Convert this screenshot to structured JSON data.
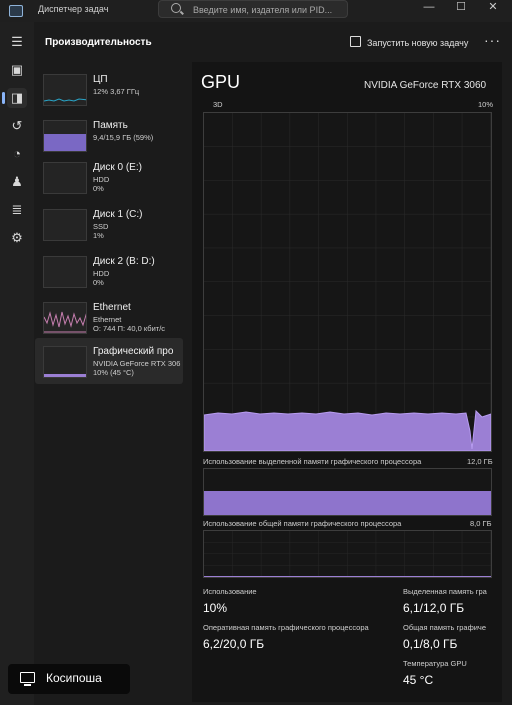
{
  "app": {
    "title": "Диспетчер задач"
  },
  "search": {
    "placeholder": "Введите имя, издателя или PID..."
  },
  "window_controls": {
    "minimize": "—",
    "maximize": "☐",
    "close": "✕"
  },
  "header": {
    "title": "Производительность",
    "run_task": "Запустить новую задачу",
    "more": "···"
  },
  "nav_icons": [
    "menu-icon",
    "processes-icon",
    "performance-icon",
    "history-icon",
    "startup-icon",
    "users-icon",
    "details-icon",
    "services-icon"
  ],
  "devices": [
    {
      "name": "ЦП",
      "line2": "12% 3,67 ГГц",
      "line3": "",
      "line4": ""
    },
    {
      "name": "Память",
      "line2": "9,4/15,9 ГБ (59%)",
      "line3": "",
      "line4": ""
    },
    {
      "name": "Диск 0 (E:)",
      "line2": "HDD",
      "line3": "0%",
      "line4": ""
    },
    {
      "name": "Диск 1 (C:)",
      "line2": "SSD",
      "line3": "1%",
      "line4": ""
    },
    {
      "name": "Диск 2 (B: D:)",
      "line2": "HDD",
      "line3": "0%",
      "line4": ""
    },
    {
      "name": "Ethernet",
      "line2": "Ethernet",
      "line3": "О: 744 П: 40,0 кбит/с",
      "line4": ""
    },
    {
      "name": "Графический про",
      "line2": "NVIDIA GeForce RTX 306",
      "line3": "10% (45 °C)",
      "line4": ""
    }
  ],
  "gpu": {
    "title": "GPU",
    "name": "NVIDIA GeForce RTX 3060",
    "engine_label": "3D",
    "engine_max": "10%",
    "dedicated_label": "Использование выделенной памяти графического процессора",
    "dedicated_max": "12,0 ГБ",
    "shared_label": "Использование общей памяти графического процессора",
    "shared_max": "8,0 ГБ"
  },
  "stats": {
    "usage_label": "Использование",
    "usage_value": "10%",
    "gpu_mem_label": "Оперативная память графического процессора",
    "gpu_mem_value": "6,2/20,0 ГБ",
    "dedicated_label": "Выделенная память гра",
    "dedicated_value": "6,1/12,0 ГБ",
    "shared_label": "Общая память графиче",
    "shared_value": "0,1/8,0 ГБ",
    "temp_label": "Температура GPU",
    "temp_value": "45 °C"
  },
  "toast": {
    "label": "Косипоша"
  },
  "colors": {
    "accent": "#8ab4f8",
    "gpu": "#9b7fd4",
    "cpu": "#2aa6c9",
    "memory": "#8a74d6",
    "ethernet": "#c77fb0"
  }
}
